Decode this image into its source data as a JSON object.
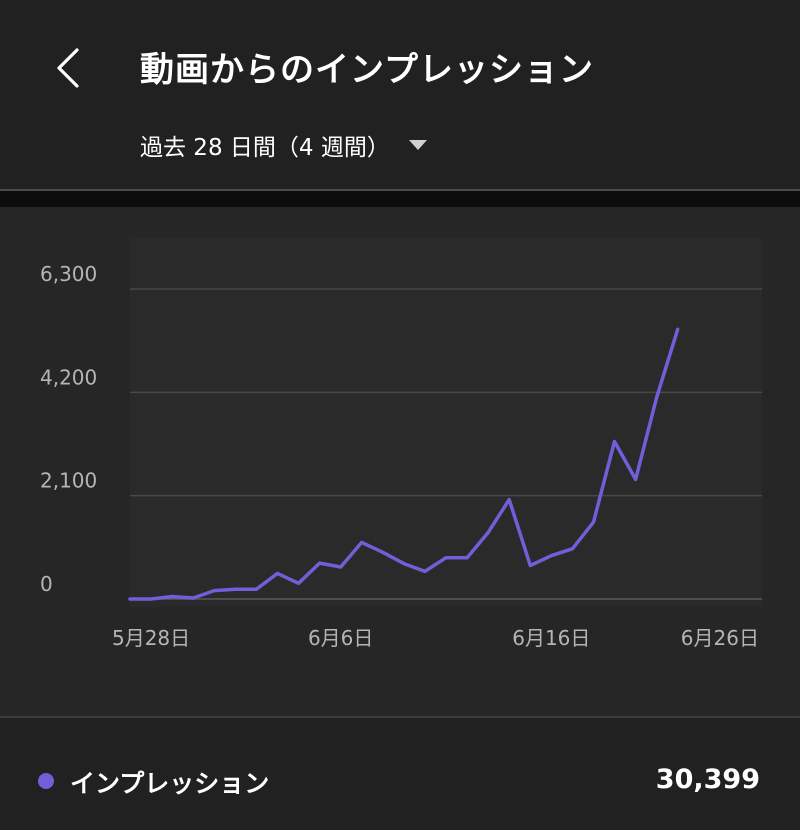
{
  "header": {
    "title": "動画からのインプレッション",
    "period_label": "過去 28 日間（4 週間）"
  },
  "icons": {
    "back": "chevron-left-icon",
    "dropdown": "caret-down-icon"
  },
  "colors": {
    "series": "#6f5fd8",
    "grid": "#484848",
    "axis_text": "#b5b5b5",
    "background": "#262626"
  },
  "chart_data": {
    "type": "line",
    "title": "",
    "xlabel": "",
    "ylabel": "",
    "ylim": [
      0,
      6300
    ],
    "yticks": [
      0,
      2100,
      4200,
      6300
    ],
    "y_tick_labels": [
      "0",
      "2,100",
      "4,200",
      "6,300"
    ],
    "x_tick_labels": [
      "5月28日",
      "6月6日",
      "6月16日",
      "6月26日"
    ],
    "x_tick_days": [
      0,
      9,
      19,
      27
    ],
    "grid": true,
    "legend": "bottom",
    "series": [
      {
        "name": "インプレッション",
        "color": "#6f5fd8",
        "x": [
          -1,
          0,
          1,
          2,
          3,
          4,
          5,
          6,
          7,
          8,
          9,
          10,
          11,
          12,
          13,
          14,
          15,
          16,
          17,
          18,
          19,
          20,
          21,
          22,
          23,
          24,
          25,
          26,
          27
        ],
        "values": [
          0,
          0,
          50,
          20,
          170,
          200,
          200,
          520,
          320,
          730,
          650,
          1150,
          950,
          720,
          560,
          840,
          840,
          1350,
          2020,
          680,
          880,
          1020,
          1560,
          3200,
          2430,
          4100,
          5480,
          null,
          null
        ]
      }
    ],
    "total_label": "30,399"
  }
}
